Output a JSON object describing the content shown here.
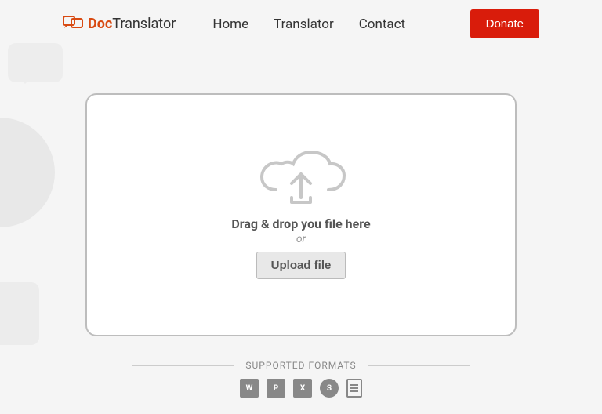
{
  "brand": {
    "bold": "Doc",
    "rest": "Translator"
  },
  "nav": {
    "home": "Home",
    "translator": "Translator",
    "contact": "Contact",
    "donate": "Donate"
  },
  "dropzone": {
    "drag_text": "Drag & drop you file here",
    "or": "or",
    "upload_label": "Upload file"
  },
  "formats": {
    "heading": "SUPPORTED FORMATS",
    "icons": [
      "W",
      "P",
      "X",
      "S",
      ""
    ]
  }
}
